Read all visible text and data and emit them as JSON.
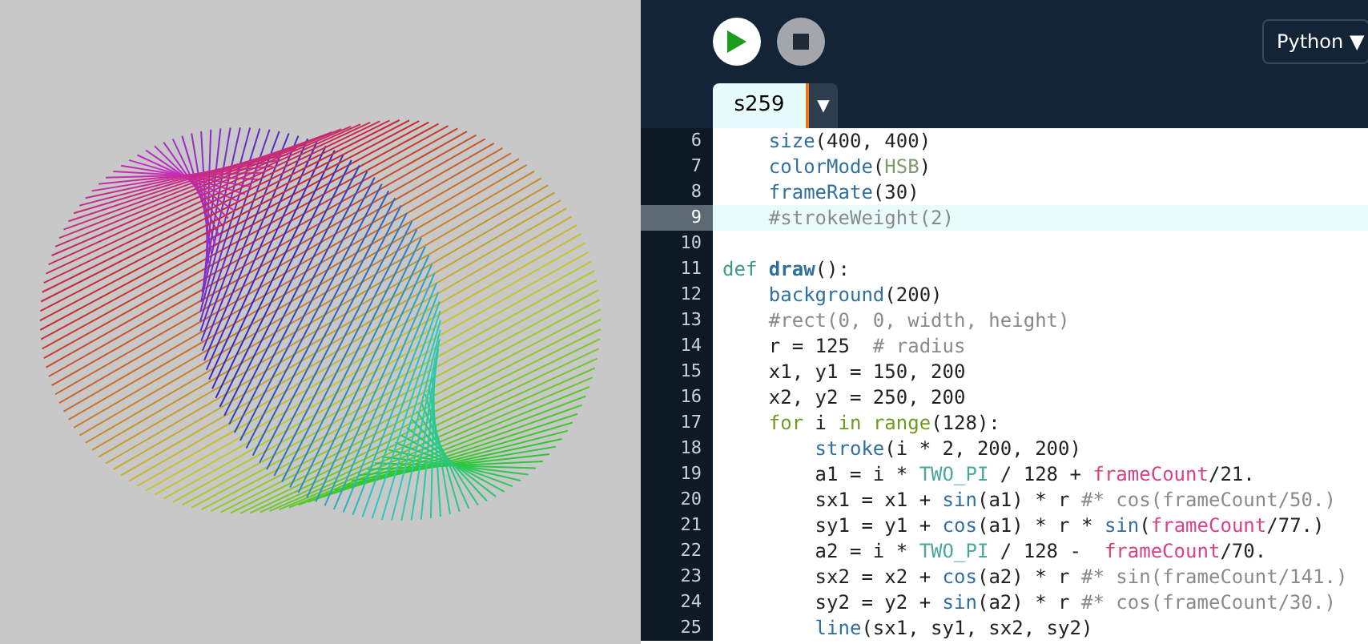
{
  "toolbar": {
    "run": {
      "kind": "play"
    },
    "stop": {
      "kind": "stop"
    },
    "language": {
      "label": "Python",
      "arrow": "▼"
    }
  },
  "tabs": [
    {
      "label": "s259",
      "selected": true,
      "menu_arrow": "▼"
    }
  ],
  "editor": {
    "lines": [
      {
        "number": "6",
        "active": false,
        "tokens": [
          {
            "kind": "builtin",
            "text": "    size"
          },
          {
            "kind": "plain",
            "text": "(400, 400)"
          }
        ]
      },
      {
        "number": "7",
        "active": false,
        "tokens": [
          {
            "kind": "builtin",
            "text": "    colorMode"
          },
          {
            "kind": "plain",
            "text": "("
          },
          {
            "kind": "mode",
            "text": "HSB"
          },
          {
            "kind": "plain",
            "text": ")"
          }
        ]
      },
      {
        "number": "8",
        "active": false,
        "tokens": [
          {
            "kind": "builtin",
            "text": "    frameRate"
          },
          {
            "kind": "plain",
            "text": "(30)"
          }
        ]
      },
      {
        "number": "9",
        "active": true,
        "tokens": [
          {
            "kind": "comment",
            "text": "    #strokeWeight(2)"
          }
        ]
      },
      {
        "number": "10",
        "active": false
      },
      {
        "number": "11",
        "active": false,
        "tokens": [
          {
            "kind": "keyword",
            "text": "def "
          },
          {
            "kind": "function",
            "text": "draw"
          },
          {
            "kind": "plain",
            "text": "():"
          }
        ]
      },
      {
        "number": "12",
        "active": false,
        "tokens": [
          {
            "kind": "builtin",
            "text": "    background"
          },
          {
            "kind": "plain",
            "text": "(200)"
          }
        ]
      },
      {
        "number": "13",
        "active": false,
        "tokens": [
          {
            "kind": "comment",
            "text": "    #rect(0, 0, width, height)"
          }
        ]
      },
      {
        "number": "14",
        "active": false,
        "tokens": [
          {
            "kind": "plain",
            "text": "    r = 125  "
          },
          {
            "kind": "comment",
            "text": "# radius"
          }
        ]
      },
      {
        "number": "15",
        "active": false,
        "tokens": [
          {
            "kind": "plain",
            "text": "    x1, y1 = 150, 200"
          }
        ]
      },
      {
        "number": "16",
        "active": false,
        "tokens": [
          {
            "kind": "plain",
            "text": "    x2, y2 = 250, 200"
          }
        ]
      },
      {
        "number": "17",
        "active": false,
        "tokens": [
          {
            "kind": "control",
            "text": "    for"
          },
          {
            "kind": "plain",
            "text": " i "
          },
          {
            "kind": "control",
            "text": "in range"
          },
          {
            "kind": "plain",
            "text": "(128):"
          }
        ]
      },
      {
        "number": "18",
        "active": false,
        "tokens": [
          {
            "kind": "builtin",
            "text": "        stroke"
          },
          {
            "kind": "plain",
            "text": "(i * 2, 200, 200)"
          }
        ]
      },
      {
        "number": "19",
        "active": false,
        "tokens": [
          {
            "kind": "plain",
            "text": "        a1 = i * "
          },
          {
            "kind": "constant",
            "text": "TWO_PI"
          },
          {
            "kind": "plain",
            "text": " / 128 + "
          },
          {
            "kind": "variable",
            "text": "frameCount"
          },
          {
            "kind": "plain",
            "text": "/21."
          }
        ]
      },
      {
        "number": "20",
        "active": false,
        "tokens": [
          {
            "kind": "plain",
            "text": "        sx1 = x1 + "
          },
          {
            "kind": "builtin",
            "text": "sin"
          },
          {
            "kind": "plain",
            "text": "(a1) * r "
          },
          {
            "kind": "comment",
            "text": "#* cos(frameCount/50.)"
          }
        ]
      },
      {
        "number": "21",
        "active": false,
        "tokens": [
          {
            "kind": "plain",
            "text": "        sy1 = y1 + "
          },
          {
            "kind": "builtin",
            "text": "cos"
          },
          {
            "kind": "plain",
            "text": "(a1) * r * "
          },
          {
            "kind": "builtin",
            "text": "sin"
          },
          {
            "kind": "plain",
            "text": "("
          },
          {
            "kind": "variable",
            "text": "frameCount"
          },
          {
            "kind": "plain",
            "text": "/77.)"
          }
        ]
      },
      {
        "number": "22",
        "active": false,
        "tokens": [
          {
            "kind": "plain",
            "text": "        a2 = i * "
          },
          {
            "kind": "constant",
            "text": "TWO_PI"
          },
          {
            "kind": "plain",
            "text": " / 128 -  "
          },
          {
            "kind": "variable",
            "text": "frameCount"
          },
          {
            "kind": "plain",
            "text": "/70."
          }
        ]
      },
      {
        "number": "23",
        "active": false,
        "tokens": [
          {
            "kind": "plain",
            "text": "        sx2 = x2 + "
          },
          {
            "kind": "builtin",
            "text": "cos"
          },
          {
            "kind": "plain",
            "text": "(a2) * r "
          },
          {
            "kind": "comment",
            "text": "#* sin(frameCount/141.)"
          }
        ]
      },
      {
        "number": "24",
        "active": false,
        "tokens": [
          {
            "kind": "plain",
            "text": "        sy2 = y2 + "
          },
          {
            "kind": "builtin",
            "text": "sin"
          },
          {
            "kind": "plain",
            "text": "(a2) * r "
          },
          {
            "kind": "comment",
            "text": "#* cos(frameCount/30.)"
          }
        ]
      },
      {
        "number": "25",
        "active": false,
        "tokens": [
          {
            "kind": "builtin",
            "text": "        line"
          },
          {
            "kind": "plain",
            "text": "(sx1, sy1, sx2, sy2)"
          }
        ]
      }
    ]
  }
}
